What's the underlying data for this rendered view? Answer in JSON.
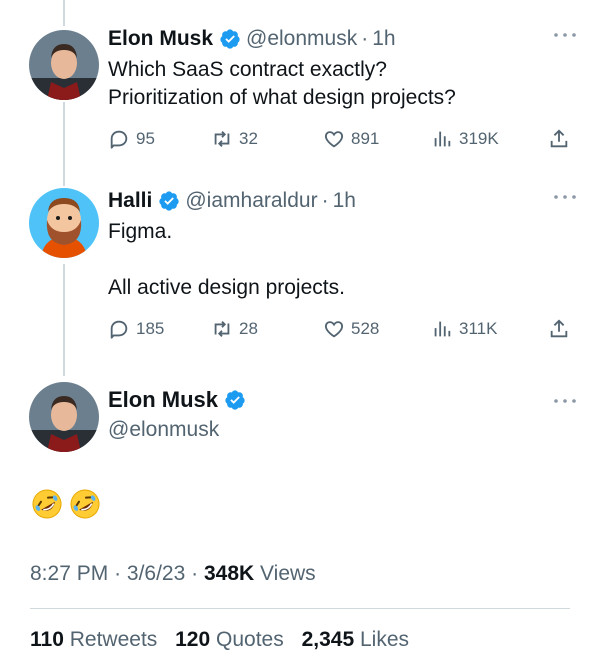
{
  "colors": {
    "text": "#0f1419",
    "muted": "#536471",
    "verified": "#1d9bf0",
    "divider": "#cfd9de"
  },
  "tweets": [
    {
      "name": "Elon Musk",
      "handle": "@elonmusk",
      "separator": "·",
      "time": "1h",
      "lines": [
        "Which SaaS contract exactly?",
        "Prioritization of what design projects?"
      ],
      "replies": "95",
      "retweets": "32",
      "likes": "891",
      "views": "319K"
    },
    {
      "name": "Halli",
      "handle": "@iamharaldur",
      "separator": "·",
      "time": "1h",
      "lines": [
        "Figma.",
        "",
        "All active design projects."
      ],
      "replies": "185",
      "retweets": "28",
      "likes": "528",
      "views": "311K"
    }
  ],
  "main": {
    "name": "Elon Musk",
    "handle": "@elonmusk",
    "emoji": [
      "rolling-on-floor-laughing",
      "rolling-on-floor-laughing"
    ],
    "time": "8:27 PM",
    "sep": "·",
    "date": "3/6/23",
    "views_count": "348K",
    "views_label": "Views",
    "retweets_count": "110",
    "retweets_label": "Retweets",
    "quotes_count": "120",
    "quotes_label": "Quotes",
    "likes_count": "2,345",
    "likes_label": "Likes"
  }
}
